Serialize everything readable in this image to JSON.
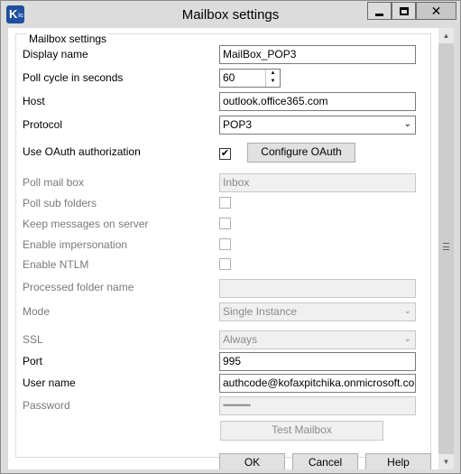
{
  "window": {
    "title": "Mailbox settings",
    "icon": "k-icon"
  },
  "group": {
    "title": "Mailbox settings"
  },
  "fields": {
    "display_name": {
      "label": "Display name",
      "value": "MailBox_POP3"
    },
    "poll_cycle": {
      "label": "Poll cycle in seconds",
      "value": "60"
    },
    "host": {
      "label": "Host",
      "value": "outlook.office365.com"
    },
    "protocol": {
      "label": "Protocol",
      "value": "POP3"
    },
    "use_oauth": {
      "label": "Use OAuth authorization",
      "checked": true
    },
    "configure_oauth": {
      "label": "Configure OAuth"
    },
    "poll_mailbox": {
      "label": "Poll mail box",
      "value": "Inbox"
    },
    "poll_sub_folders": {
      "label": "Poll sub folders",
      "checked": false
    },
    "keep_messages": {
      "label": "Keep messages on server",
      "checked": false
    },
    "enable_impersonation": {
      "label": "Enable impersonation",
      "checked": false
    },
    "enable_ntlm": {
      "label": "Enable NTLM",
      "checked": false
    },
    "processed_folder": {
      "label": "Processed folder name",
      "value": ""
    },
    "mode": {
      "label": "Mode",
      "value": "Single Instance"
    },
    "ssl": {
      "label": "SSL",
      "value": "Always"
    },
    "port": {
      "label": "Port",
      "value": "995"
    },
    "user_name": {
      "label": "User name",
      "value": "authcode@kofaxpitchika.onmicrosoft.com"
    },
    "password": {
      "label": "Password",
      "value": "••••••••••••••"
    }
  },
  "buttons": {
    "test_mailbox": "Test Mailbox",
    "ok": "OK",
    "cancel": "Cancel",
    "help": "Help"
  },
  "glyphs": {
    "check": "✔",
    "chevron": "⌄",
    "up": "▲",
    "down": "▼",
    "close": "✕"
  }
}
